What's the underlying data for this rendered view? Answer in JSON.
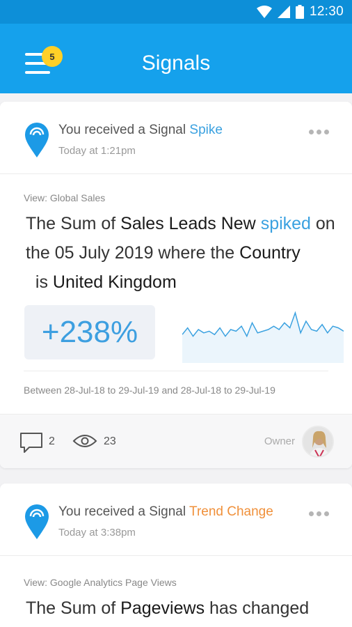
{
  "status_bar": {
    "time": "12:30"
  },
  "app_bar": {
    "title": "Signals",
    "badge_count": "5"
  },
  "cards": [
    {
      "signal_prefix": "You received a Signal ",
      "signal_type": "Spike",
      "signal_type_color": "#3aa1e0",
      "time": "Today at 1:21pm",
      "view_label": "View: Global Sales",
      "headline": {
        "p1": "The Sum of ",
        "b1": "Sales Leads New",
        "p2": " ",
        "hl": "spiked",
        "p3": " on the 05 July 2019 where the ",
        "b2": "Country",
        "p4": "  is ",
        "b3": "United Kingdom"
      },
      "percent": "+238%",
      "date_range": "Between 28-Jul-18 to 29-Jul-19 and 28-Jul-18 to 29-Jul-19",
      "comments": "2",
      "views": "23",
      "owner_label": "Owner",
      "sparkline": [
        0.35,
        0.55,
        0.3,
        0.5,
        0.4,
        0.45,
        0.35,
        0.55,
        0.3,
        0.5,
        0.45,
        0.6,
        0.3,
        0.7,
        0.4,
        0.45,
        0.5,
        0.6,
        0.5,
        0.7,
        0.55,
        1.0,
        0.4,
        0.75,
        0.5,
        0.45,
        0.65,
        0.4,
        0.6,
        0.55,
        0.45
      ]
    },
    {
      "signal_prefix": "You received a Signal ",
      "signal_type": "Trend Change",
      "signal_type_color": "#f0903a",
      "time": "Today at 3:38pm",
      "view_label": "View: Google Analytics Page Views",
      "headline": {
        "p1": "The Sum of ",
        "b1": "Pageviews",
        "p2": " has changed"
      }
    }
  ],
  "colors": {
    "status_bar": "#0d8fd8",
    "app_bar": "#15a1ec",
    "accent_blue": "#3aa1e0",
    "accent_orange": "#f0903a",
    "badge": "#ffd028"
  }
}
